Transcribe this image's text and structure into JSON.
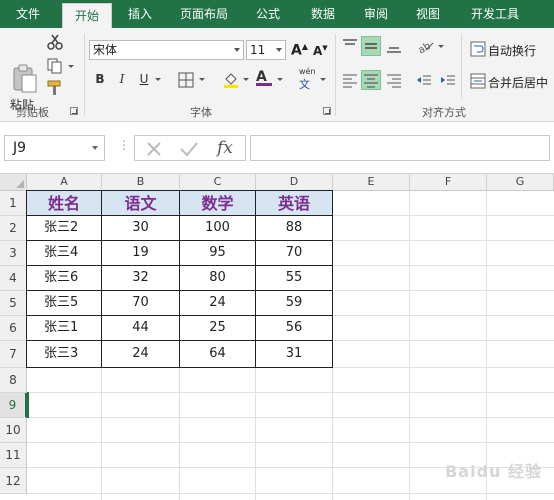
{
  "ribbon": {
    "tabs": [
      "文件",
      "开始",
      "插入",
      "页面布局",
      "公式",
      "数据",
      "审阅",
      "视图",
      "开发工具"
    ],
    "active_tab": "开始",
    "clipboard": {
      "paste_label": "粘贴",
      "group_label": "剪贴板"
    },
    "font": {
      "font_name": "宋体",
      "font_size": "11",
      "bold": "B",
      "italic": "I",
      "underline": "U",
      "group_label": "字体",
      "phonetic": "wén"
    },
    "alignment": {
      "wrap_text": "自动换行",
      "merge_center": "合并后居中",
      "group_label": "对齐方式"
    }
  },
  "formula_bar": {
    "name_box": "J9",
    "fx": "fx",
    "formula": ""
  },
  "sheet": {
    "column_headers": [
      "A",
      "B",
      "C",
      "D",
      "E",
      "F",
      "G"
    ],
    "row_headers": [
      "1",
      "2",
      "3",
      "4",
      "5",
      "6",
      "7",
      "8",
      "9",
      "10",
      "11",
      "12"
    ],
    "selected_row": "9",
    "table_header": [
      "姓名",
      "语文",
      "数学",
      "英语"
    ],
    "table_rows": [
      [
        "张三2",
        "30",
        "100",
        "88"
      ],
      [
        "张三4",
        "19",
        "95",
        "70"
      ],
      [
        "张三6",
        "32",
        "80",
        "55"
      ],
      [
        "张三5",
        "70",
        "24",
        "59"
      ],
      [
        "张三1",
        "44",
        "25",
        "56"
      ],
      [
        "张三3",
        "24",
        "64",
        "31"
      ]
    ]
  },
  "watermark": "Baidu 经验",
  "colors": {
    "accent": "#217346",
    "header_fill": "#d7e4f2",
    "header_text": "#7a2f8e"
  }
}
